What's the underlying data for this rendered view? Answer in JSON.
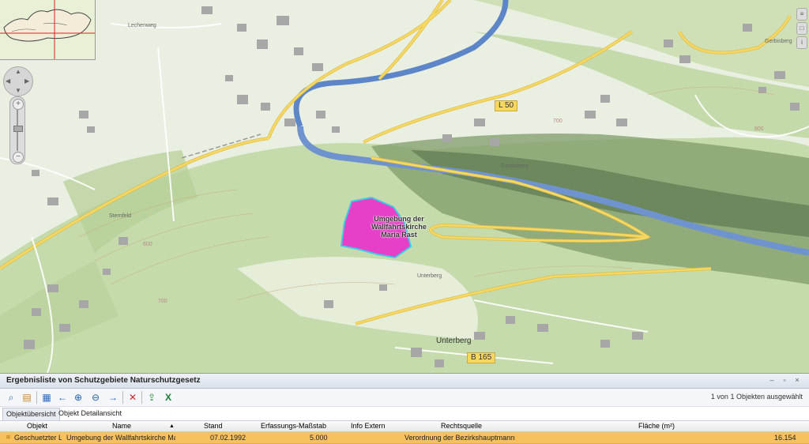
{
  "map": {
    "labels": {
      "lechenweg": "Lechenweg",
      "gerbisberg_road": "Gerbisberg",
      "gerbisberg_village": "Gerbisberg",
      "unterberg_village": "Unterberg",
      "unterberg_small": "Unterberg",
      "sternfeld": "Sternfeld",
      "contour_700a": "700",
      "contour_700b": "700",
      "contour_800": "800",
      "contour_600": "600",
      "l50": "L 50",
      "b165": "B 165"
    },
    "polygon": {
      "line1": "Umgebung der",
      "line2": "Wallfahrtskirche",
      "line3": "Maria Rast",
      "fill": "#e640c8",
      "stroke": "#3cc8e6"
    },
    "colors": {
      "terrain": "#e8efe0",
      "forest": "#b9d39a",
      "river": "#5d86c9",
      "road_major": "#f3d45b"
    }
  },
  "nav": {
    "pan_up": "▲",
    "pan_down": "▼",
    "pan_left": "◀",
    "pan_right": "▶",
    "zoom_in": "+",
    "zoom_out": "−"
  },
  "panel": {
    "title": "Ergebnisliste von Schutzgebiete Naturschutzgesetz",
    "status": "1 von 1 Objekten ausgewählt",
    "tabs": [
      "Objektübersicht",
      "Objekt Detailansicht"
    ],
    "columns": [
      "Objekt",
      "Name",
      "Stand",
      "Erfassungs-Maßstab",
      "Info Extern",
      "Rechtsquelle",
      "Fläche (m²)"
    ],
    "rows": [
      {
        "objekt": "Geschuetzter La",
        "name": "Umgebung der Wallfahrtskirche Maria",
        "stand": "07.02.1992",
        "massstab": "5.000",
        "info": "",
        "rechtsquelle": "Verordnung der Bezirkshauptmannsc",
        "flaeche": "16.154"
      }
    ],
    "sort_indicator": "▲",
    "row_highlight": "#f6c15e"
  }
}
